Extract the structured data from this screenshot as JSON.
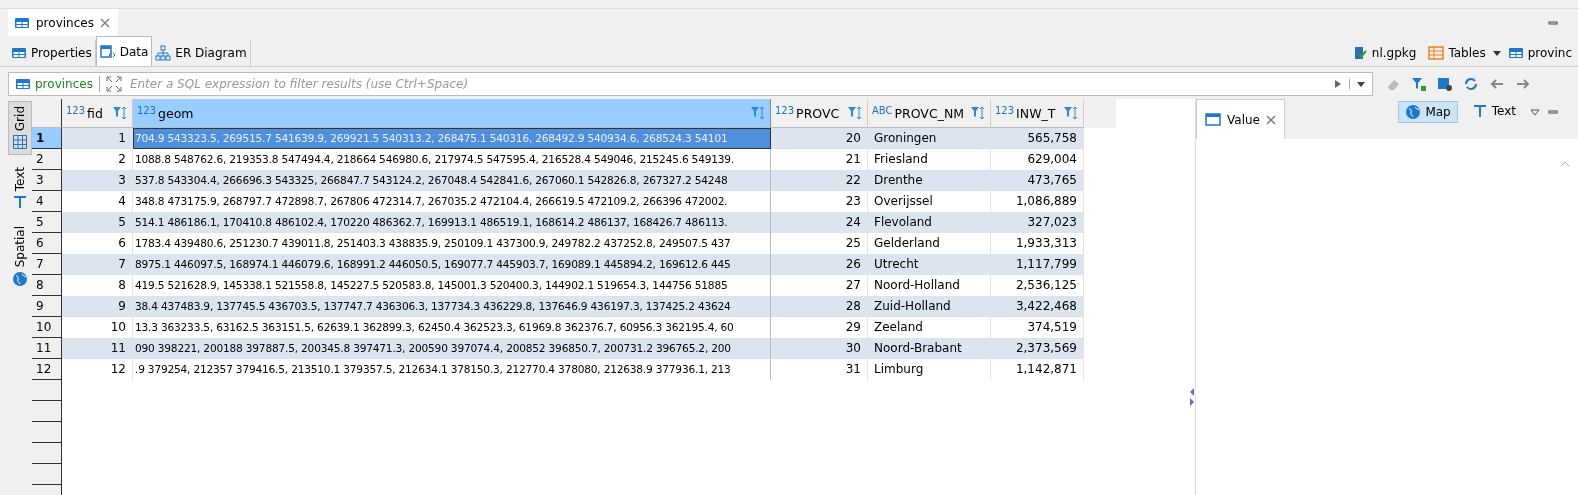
{
  "editor_tab": {
    "title": "provinces"
  },
  "subtabs": [
    {
      "label": "Properties",
      "selected": false
    },
    {
      "label": "Data",
      "selected": true
    },
    {
      "label": "ER Diagram",
      "selected": false
    }
  ],
  "breadcrumbs": [
    {
      "label": "nl.gpkg"
    },
    {
      "label": "Tables"
    },
    {
      "label": "provinc"
    }
  ],
  "filter": {
    "table": "provinces",
    "placeholder": "Enter a SQL expression to filter results (use Ctrl+Space)"
  },
  "side_tabs": [
    {
      "label": "Grid",
      "selected": true
    },
    {
      "label": "Text",
      "selected": false
    },
    {
      "label": "Spatial",
      "selected": false
    }
  ],
  "table": {
    "columns": [
      {
        "name": "fid",
        "type": "123"
      },
      {
        "name": "geom",
        "type": "123"
      },
      {
        "name": "PROVC",
        "type": "123"
      },
      {
        "name": "PROVC_NM",
        "type": "ABC"
      },
      {
        "name": "INW_T",
        "type": "123"
      }
    ],
    "rows": [
      {
        "num": "1",
        "selected": true,
        "cells": [
          "1",
          "704.9 543323.5, 269515.7 541639.9, 269921.5 540313.2, 268475.1 540316, 268492.9 540934.6, 268524.3 54101",
          "20",
          "Groningen",
          "565,758"
        ]
      },
      {
        "num": "2",
        "selected": false,
        "cells": [
          "2",
          "1088.8 548762.6, 219353.8 547494.4, 218664 546980.6, 217974.5 547595.4, 216528.4 549046, 215245.6 549139.",
          "21",
          "Friesland",
          "629,004"
        ]
      },
      {
        "num": "3",
        "selected": false,
        "cells": [
          "3",
          "537.8 543304.4, 266696.3 543325, 266847.7 543124.2, 267048.4 542841.6, 267060.1 542826.8, 267327.2 54248",
          "22",
          "Drenthe",
          "473,765"
        ]
      },
      {
        "num": "4",
        "selected": false,
        "cells": [
          "4",
          "348.8 473175.9, 268797.7 472898.7, 267806 472314.7, 267035.2 472104.4, 266619.5 472109.2, 266396 472002.",
          "23",
          "Overijssel",
          "1,086,889"
        ]
      },
      {
        "num": "5",
        "selected": false,
        "cells": [
          "5",
          "514.1 486186.1, 170410.8 486102.4, 170220 486362.7, 169913.1 486519.1, 168614.2 486137, 168426.7 486113.",
          "24",
          "Flevoland",
          "327,023"
        ]
      },
      {
        "num": "6",
        "selected": false,
        "cells": [
          "6",
          "1783.4 439480.6, 251230.7 439011.8, 251403.3 438835.9, 250109.1 437300.9, 249782.2 437252.8, 249507.5 437",
          "25",
          "Gelderland",
          "1,933,313"
        ]
      },
      {
        "num": "7",
        "selected": false,
        "cells": [
          "7",
          "8975.1 446097.5, 168974.1 446079.6, 168991.2 446050.5, 169077.7 445903.7, 169089.1 445894.2, 169612.6 445",
          "26",
          "Utrecht",
          "1,117,799"
        ]
      },
      {
        "num": "8",
        "selected": false,
        "cells": [
          "8",
          "419.5 521628.9, 145338.1 521558.8, 145227.5 520583.8, 145001.3 520400.3, 144902.1 519654.3, 144756 51885",
          "27",
          "Noord-Holland",
          "2,536,125"
        ]
      },
      {
        "num": "9",
        "selected": false,
        "cells": [
          "9",
          "38.4 437483.9, 137745.5 436703.5, 137747.7 436306.3, 137734.3 436229.8, 137646.9 436197.3, 137425.2 43624",
          "28",
          "Zuid-Holland",
          "3,422,468"
        ]
      },
      {
        "num": "10",
        "selected": false,
        "cells": [
          "10",
          "13.3 363233.5, 63162.5 363151.5, 62639.1 362899.3, 62450.4 362523.3, 61969.8 362376.7, 60956.3 362195.4, 60",
          "29",
          "Zeeland",
          "374,519"
        ]
      },
      {
        "num": "11",
        "selected": false,
        "cells": [
          "11",
          "090 398221, 200188 397887.5, 200345.8 397471.3, 200590 397074.4, 200852 396850.7, 200731.2 396765.2, 200",
          "30",
          "Noord-Brabant",
          "2,373,569"
        ]
      },
      {
        "num": "12",
        "selected": false,
        "cells": [
          "12",
          ".9 379254, 212357 379416.5, 213510.1 379357.5, 212634.1 378150.3, 212770.4 378080, 212638.9 377936.1, 213",
          "31",
          "Limburg",
          "1,142,871"
        ]
      }
    ]
  },
  "value_panel": {
    "tab": "Value",
    "modes": [
      {
        "label": "Map",
        "selected": true
      },
      {
        "label": "Text",
        "selected": false
      }
    ]
  }
}
